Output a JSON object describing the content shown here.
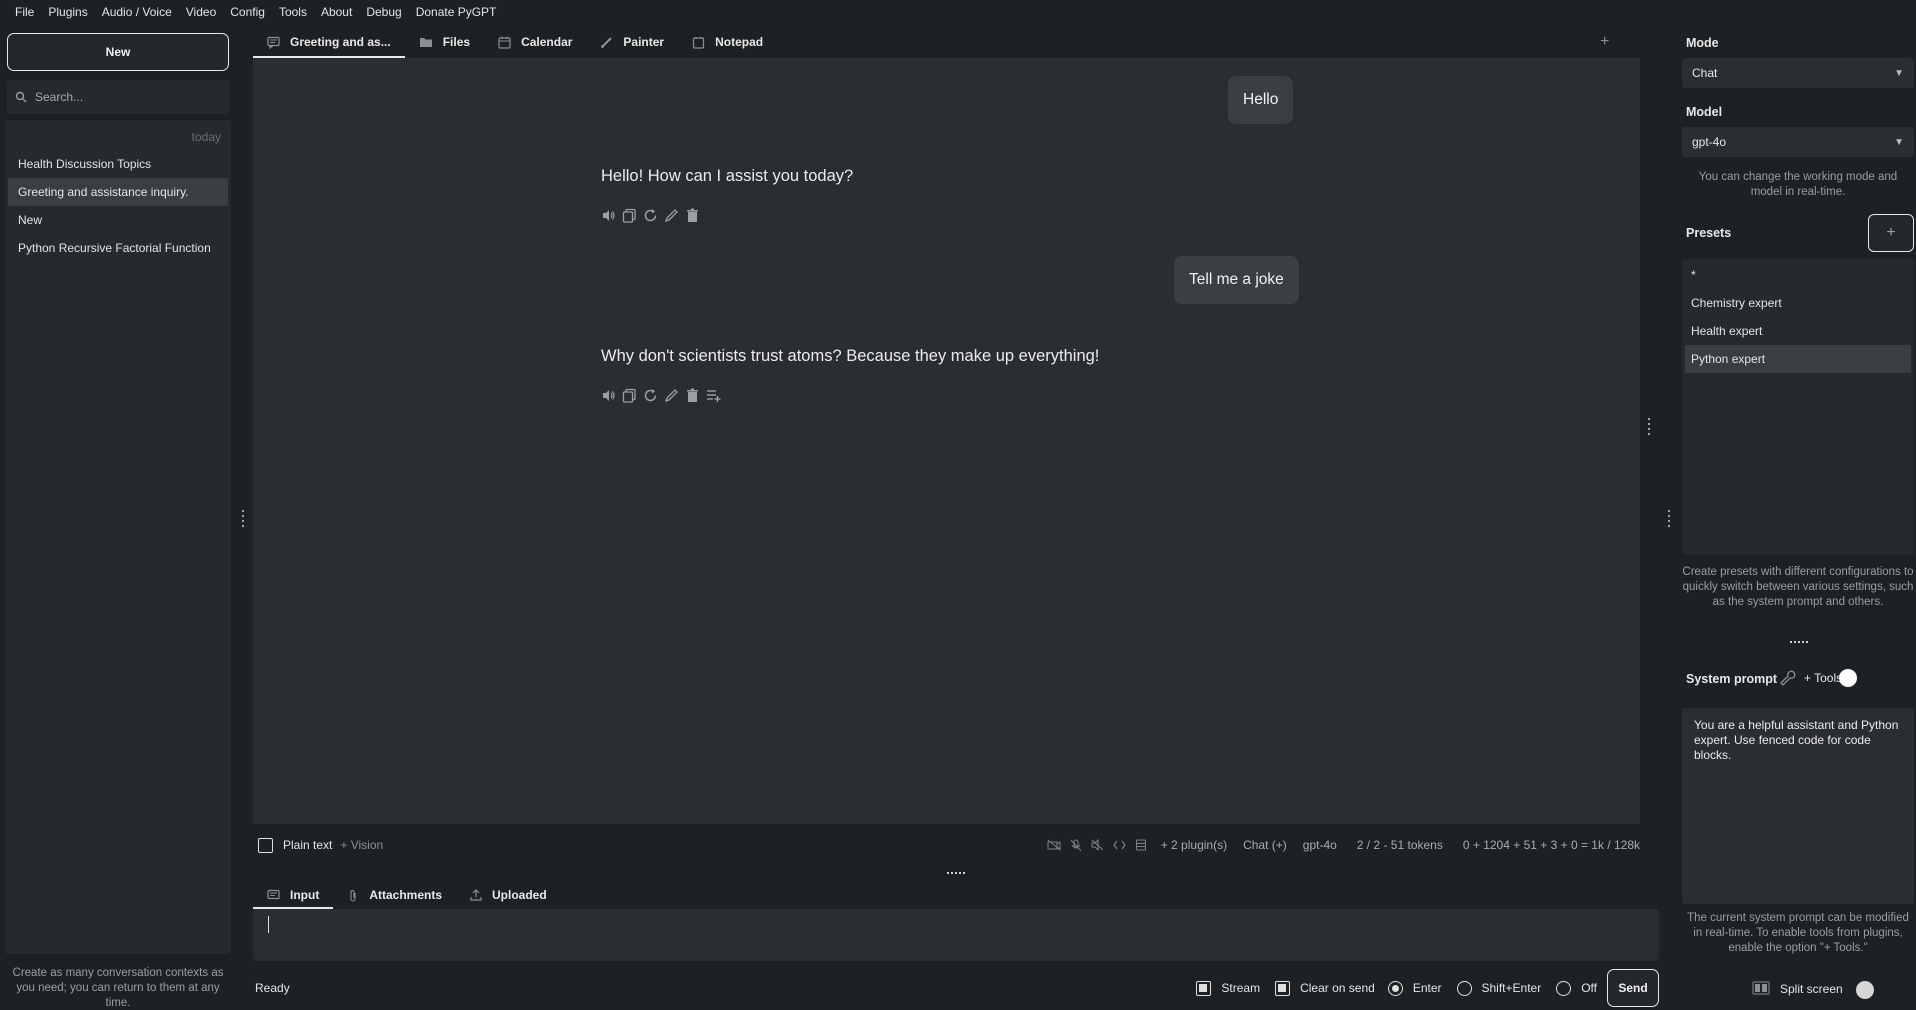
{
  "menu": [
    "File",
    "Plugins",
    "Audio / Voice",
    "Video",
    "Config",
    "Tools",
    "About",
    "Debug",
    "Donate PyGPT"
  ],
  "left": {
    "new_label": "New",
    "search_placeholder": "Search...",
    "group_label": "today",
    "contexts": [
      {
        "label": "Health Discussion Topics",
        "selected": false
      },
      {
        "label": "Greeting and assistance inquiry.",
        "selected": true
      },
      {
        "label": "New",
        "selected": false
      },
      {
        "label": "Python Recursive Factorial Function",
        "selected": false
      }
    ],
    "help": "Create as many conversation contexts as you need; you can return to them at any time."
  },
  "tabs": [
    "Greeting and as...",
    "Files",
    "Calendar",
    "Painter",
    "Notepad"
  ],
  "add_tab": "+",
  "chat": {
    "user_1": "Hello",
    "assistant_1": "Hello! How can I assist you today?",
    "user_2": "Tell me a joke",
    "assistant_2": "Why don't scientists trust atoms? Because they make up everything!"
  },
  "status": {
    "plain_text": "Plain text",
    "vision": "+ Vision",
    "plugins": "+ 2 plugin(s)",
    "mode": "Chat (+)",
    "model": "gpt-4o",
    "ctx_tokens": "2 / 2 - 51 tokens",
    "token_sum": "0 + 1204 + 51 + 3 + 0 = 1k / 128k"
  },
  "input_tabs": [
    "Input",
    "Attachments",
    "Uploaded"
  ],
  "bottom": {
    "ready": "Ready",
    "stream": "Stream",
    "clear_on_send": "Clear on send",
    "enter": "Enter",
    "shift_enter": "Shift+Enter",
    "off": "Off",
    "send": "Send"
  },
  "right": {
    "mode_label": "Mode",
    "mode_value": "Chat",
    "model_label": "Model",
    "model_value": "gpt-4o",
    "mode_help": "You can change the working mode and model in real-time.",
    "presets_label": "Presets",
    "presets": [
      {
        "label": "*",
        "selected": false
      },
      {
        "label": "Chemistry expert",
        "selected": false
      },
      {
        "label": "Health expert",
        "selected": false
      },
      {
        "label": "Python expert",
        "selected": true
      }
    ],
    "presets_help": "Create presets with different configurations to quickly switch between various settings, such as the system prompt and others.",
    "system_prompt_label": "System prompt",
    "tools_label": "+ Tools",
    "system_prompt": "You are a helpful assistant and Python expert. Use fenced code for code blocks.",
    "prompt_help": "The current system prompt can be modified in real-time. To enable tools from plugins, enable the option \"+ Tools.\"",
    "split_screen": "Split screen"
  }
}
